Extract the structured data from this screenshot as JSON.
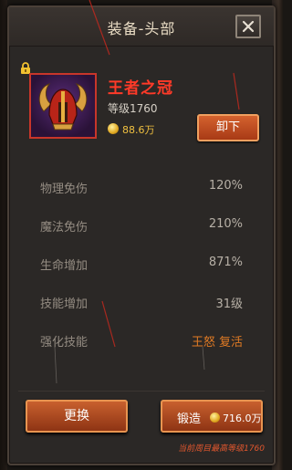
{
  "title": "装备-头部",
  "item": {
    "name": "王者之冠",
    "level": "等级1760",
    "price": "88.6万",
    "unequip_label": "卸下",
    "icon": "horned-helmet-icon"
  },
  "stats": [
    {
      "label": "物理免伤",
      "value": "120%"
    },
    {
      "label": "魔法免伤",
      "value": "210%"
    },
    {
      "label": "生命增加",
      "value": "871%"
    },
    {
      "label": "技能增加",
      "value": "31级"
    },
    {
      "label": "强化技能",
      "value": "王怒 复活"
    }
  ],
  "actions": {
    "replace_label": "更换",
    "forge_label": "锻造",
    "forge_cost": "716.0万"
  },
  "note": "当前周目最高等级1760",
  "colors": {
    "item_name": "#ff3a28",
    "special_value": "#e07a24",
    "button": "#c8602e",
    "gold": "#f0c040"
  }
}
